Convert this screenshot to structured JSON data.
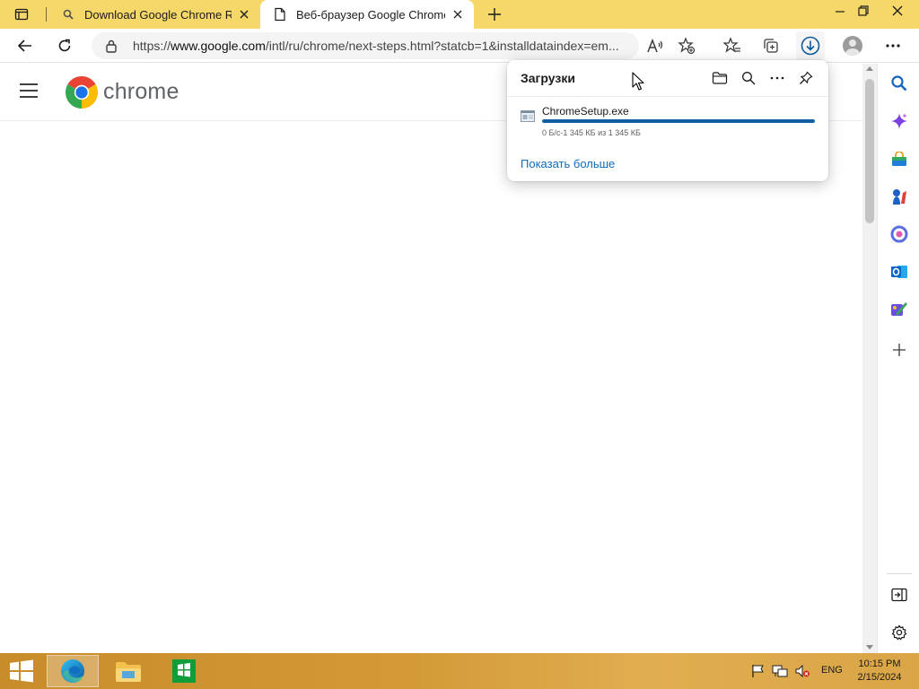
{
  "browser": {
    "tabs": [
      {
        "title": "Download Google Chrome Rus",
        "favicon": "search-icon",
        "active": false
      },
      {
        "title": "Веб-браузер Google Chrome",
        "favicon": "page-icon",
        "active": true
      }
    ]
  },
  "toolbar": {
    "url_prefix": "https://",
    "url_host": "www.google.com",
    "url_path": "/intl/ru/chrome/next-steps.html?statcb=1&installdataindex=em..."
  },
  "page": {
    "brand_word": "chrome"
  },
  "downloads": {
    "title": "Загрузки",
    "items": [
      {
        "filename": "ChromeSetup.exe",
        "status": "0 Б/с-1 345 КБ из 1 345 КБ",
        "progress": 1.0
      }
    ],
    "show_more_label": "Показать больше"
  },
  "taskbar": {
    "language": "ENG",
    "time": "10:15 PM",
    "date": "2/15/2024"
  },
  "colors": {
    "tabstrip": "#f5d76a",
    "accent_blue": "#0f6cbd",
    "progress": "#115ea3",
    "taskbar": "#d49a38"
  }
}
